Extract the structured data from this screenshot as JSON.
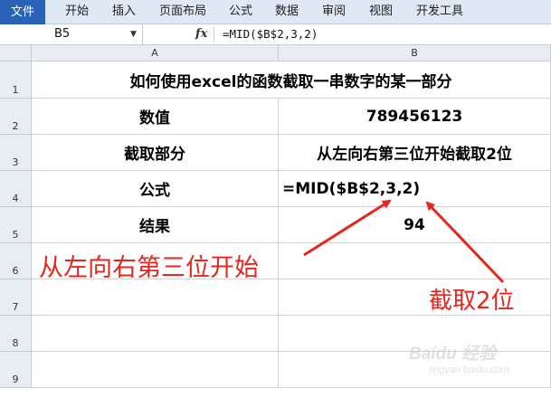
{
  "ribbon": {
    "file_tab": "文件",
    "tabs": [
      "开始",
      "插入",
      "页面布局",
      "公式",
      "数据",
      "审阅",
      "视图",
      "开发工具"
    ]
  },
  "formula_bar": {
    "name_box": "B5",
    "fx_icon": "fx",
    "formula": "=MID($B$2,3,2)"
  },
  "columns": [
    "A",
    "B"
  ],
  "rows": [
    "1",
    "2",
    "3",
    "4",
    "5",
    "6",
    "7",
    "8",
    "9"
  ],
  "cells": {
    "title": "如何使用excel的函数截取一串数字的某一部分",
    "a2": "数值",
    "b2": "789456123",
    "a3": "截取部分",
    "b3": "从左向右第三位开始截取2位",
    "a4": "公式",
    "b4": "=MID($B$2,3,2)",
    "a5": "结果",
    "b5": "94"
  },
  "annotations": {
    "start": "从左向右第三位开始",
    "length": "截取2位",
    "color": "#e8251f"
  },
  "watermark": {
    "text": "Baidu 经验",
    "sub": "jingyan.baidu.com"
  }
}
